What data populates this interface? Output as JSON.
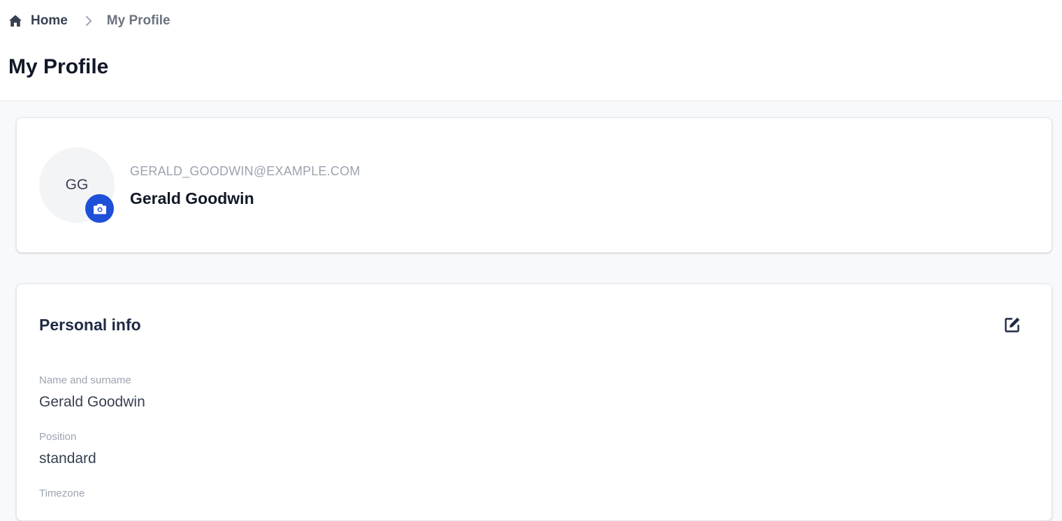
{
  "breadcrumb": {
    "home_label": "Home",
    "current_label": "My Profile"
  },
  "page": {
    "title": "My Profile"
  },
  "profile": {
    "initials": "GG",
    "email": "GERALD_GOODWIN@EXAMPLE.COM",
    "name": "Gerald Goodwin"
  },
  "personal_info": {
    "title": "Personal info",
    "fields": [
      {
        "label": "Name and surname",
        "value": "Gerald Goodwin"
      },
      {
        "label": "Position",
        "value": "standard"
      },
      {
        "label": "Timezone",
        "value": ""
      }
    ]
  },
  "colors": {
    "accent": "#1d4fd8",
    "text_dark": "#111827",
    "text_muted": "#9ca3af",
    "background": "#f8f9fb"
  },
  "icons": {
    "home": "home-icon",
    "chevron": "chevron-right-icon",
    "camera": "camera-icon",
    "edit": "edit-icon"
  }
}
